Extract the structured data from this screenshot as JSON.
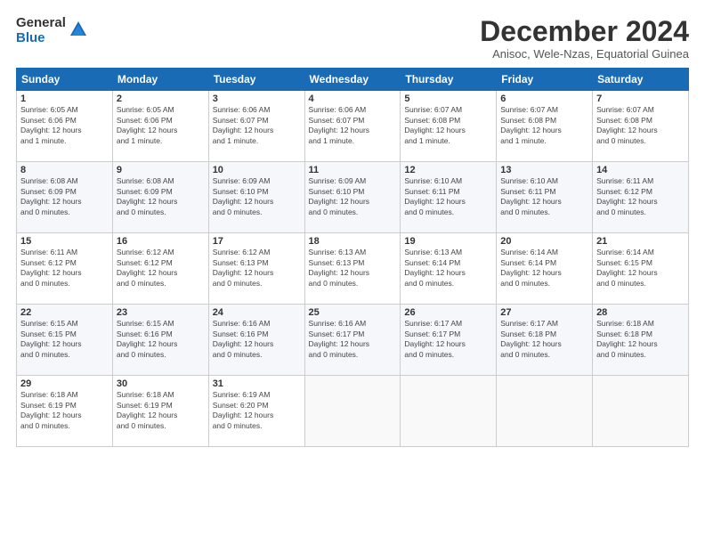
{
  "logo": {
    "general": "General",
    "blue": "Blue"
  },
  "title": "December 2024",
  "subtitle": "Anisoc, Wele-Nzas, Equatorial Guinea",
  "headers": [
    "Sunday",
    "Monday",
    "Tuesday",
    "Wednesday",
    "Thursday",
    "Friday",
    "Saturday"
  ],
  "weeks": [
    [
      {
        "day": "1",
        "info": "Sunrise: 6:05 AM\nSunset: 6:06 PM\nDaylight: 12 hours\nand 1 minute."
      },
      {
        "day": "2",
        "info": "Sunrise: 6:05 AM\nSunset: 6:06 PM\nDaylight: 12 hours\nand 1 minute."
      },
      {
        "day": "3",
        "info": "Sunrise: 6:06 AM\nSunset: 6:07 PM\nDaylight: 12 hours\nand 1 minute."
      },
      {
        "day": "4",
        "info": "Sunrise: 6:06 AM\nSunset: 6:07 PM\nDaylight: 12 hours\nand 1 minute."
      },
      {
        "day": "5",
        "info": "Sunrise: 6:07 AM\nSunset: 6:08 PM\nDaylight: 12 hours\nand 1 minute."
      },
      {
        "day": "6",
        "info": "Sunrise: 6:07 AM\nSunset: 6:08 PM\nDaylight: 12 hours\nand 1 minute."
      },
      {
        "day": "7",
        "info": "Sunrise: 6:07 AM\nSunset: 6:08 PM\nDaylight: 12 hours\nand 0 minutes."
      }
    ],
    [
      {
        "day": "8",
        "info": "Sunrise: 6:08 AM\nSunset: 6:09 PM\nDaylight: 12 hours\nand 0 minutes."
      },
      {
        "day": "9",
        "info": "Sunrise: 6:08 AM\nSunset: 6:09 PM\nDaylight: 12 hours\nand 0 minutes."
      },
      {
        "day": "10",
        "info": "Sunrise: 6:09 AM\nSunset: 6:10 PM\nDaylight: 12 hours\nand 0 minutes."
      },
      {
        "day": "11",
        "info": "Sunrise: 6:09 AM\nSunset: 6:10 PM\nDaylight: 12 hours\nand 0 minutes."
      },
      {
        "day": "12",
        "info": "Sunrise: 6:10 AM\nSunset: 6:11 PM\nDaylight: 12 hours\nand 0 minutes."
      },
      {
        "day": "13",
        "info": "Sunrise: 6:10 AM\nSunset: 6:11 PM\nDaylight: 12 hours\nand 0 minutes."
      },
      {
        "day": "14",
        "info": "Sunrise: 6:11 AM\nSunset: 6:12 PM\nDaylight: 12 hours\nand 0 minutes."
      }
    ],
    [
      {
        "day": "15",
        "info": "Sunrise: 6:11 AM\nSunset: 6:12 PM\nDaylight: 12 hours\nand 0 minutes."
      },
      {
        "day": "16",
        "info": "Sunrise: 6:12 AM\nSunset: 6:12 PM\nDaylight: 12 hours\nand 0 minutes."
      },
      {
        "day": "17",
        "info": "Sunrise: 6:12 AM\nSunset: 6:13 PM\nDaylight: 12 hours\nand 0 minutes."
      },
      {
        "day": "18",
        "info": "Sunrise: 6:13 AM\nSunset: 6:13 PM\nDaylight: 12 hours\nand 0 minutes."
      },
      {
        "day": "19",
        "info": "Sunrise: 6:13 AM\nSunset: 6:14 PM\nDaylight: 12 hours\nand 0 minutes."
      },
      {
        "day": "20",
        "info": "Sunrise: 6:14 AM\nSunset: 6:14 PM\nDaylight: 12 hours\nand 0 minutes."
      },
      {
        "day": "21",
        "info": "Sunrise: 6:14 AM\nSunset: 6:15 PM\nDaylight: 12 hours\nand 0 minutes."
      }
    ],
    [
      {
        "day": "22",
        "info": "Sunrise: 6:15 AM\nSunset: 6:15 PM\nDaylight: 12 hours\nand 0 minutes."
      },
      {
        "day": "23",
        "info": "Sunrise: 6:15 AM\nSunset: 6:16 PM\nDaylight: 12 hours\nand 0 minutes."
      },
      {
        "day": "24",
        "info": "Sunrise: 6:16 AM\nSunset: 6:16 PM\nDaylight: 12 hours\nand 0 minutes."
      },
      {
        "day": "25",
        "info": "Sunrise: 6:16 AM\nSunset: 6:17 PM\nDaylight: 12 hours\nand 0 minutes."
      },
      {
        "day": "26",
        "info": "Sunrise: 6:17 AM\nSunset: 6:17 PM\nDaylight: 12 hours\nand 0 minutes."
      },
      {
        "day": "27",
        "info": "Sunrise: 6:17 AM\nSunset: 6:18 PM\nDaylight: 12 hours\nand 0 minutes."
      },
      {
        "day": "28",
        "info": "Sunrise: 6:18 AM\nSunset: 6:18 PM\nDaylight: 12 hours\nand 0 minutes."
      }
    ],
    [
      {
        "day": "29",
        "info": "Sunrise: 6:18 AM\nSunset: 6:19 PM\nDaylight: 12 hours\nand 0 minutes."
      },
      {
        "day": "30",
        "info": "Sunrise: 6:18 AM\nSunset: 6:19 PM\nDaylight: 12 hours\nand 0 minutes."
      },
      {
        "day": "31",
        "info": "Sunrise: 6:19 AM\nSunset: 6:20 PM\nDaylight: 12 hours\nand 0 minutes."
      },
      {
        "day": "",
        "info": ""
      },
      {
        "day": "",
        "info": ""
      },
      {
        "day": "",
        "info": ""
      },
      {
        "day": "",
        "info": ""
      }
    ]
  ]
}
